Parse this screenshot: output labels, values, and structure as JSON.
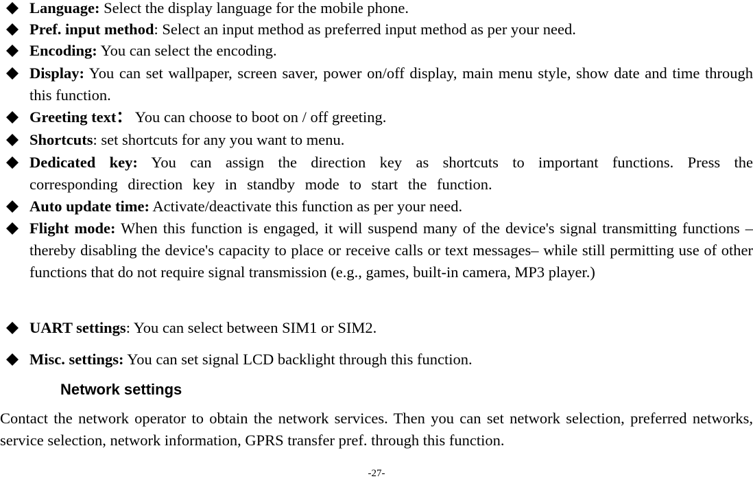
{
  "items": [
    {
      "term": "Language:",
      "desc": " Select the display language for the mobile phone."
    },
    {
      "term": "Pref. input method",
      "desc": ": Select an input method as preferred input method as per your need."
    },
    {
      "term": "Encoding:",
      "desc": " You can select the encoding."
    },
    {
      "term": "Display:",
      "desc": " You can set wallpaper, screen saver, power on/off display, main menu style, show date and time through this function."
    },
    {
      "term": "Greeting text：",
      "desc": " You can choose to boot on / off greeting."
    },
    {
      "term": "Shortcuts",
      "desc": ": set shortcuts for any you want to menu."
    },
    {
      "term": "Dedicated key:",
      "desc": " You can assign the direction key as shortcuts to important functions. Press the corresponding direction key in standby mode to start the function."
    },
    {
      "term": "Auto update time:",
      "desc": " Activate/deactivate this function as per your need."
    },
    {
      "term": "Flight mode:",
      "desc": " When this function is engaged, it will suspend many of the device's signal transmitting functions – thereby disabling the device's capacity to place or receive calls or text messages– while still permitting use of other functions that do not require signal transmission (e.g., games, built-in camera, MP3 player.)"
    },
    {
      "term": "UART settings",
      "desc": ": You can select between SIM1 or SIM2."
    },
    {
      "term": "Misc. settings:",
      "desc": " You can set signal LCD backlight through this function."
    }
  ],
  "section": {
    "heading": "Network settings",
    "paragraph": "Contact the network operator to obtain the network services. Then you can set network selection, preferred networks, service selection, network information, GPRS transfer pref. through this function."
  },
  "page_number": "-27-"
}
